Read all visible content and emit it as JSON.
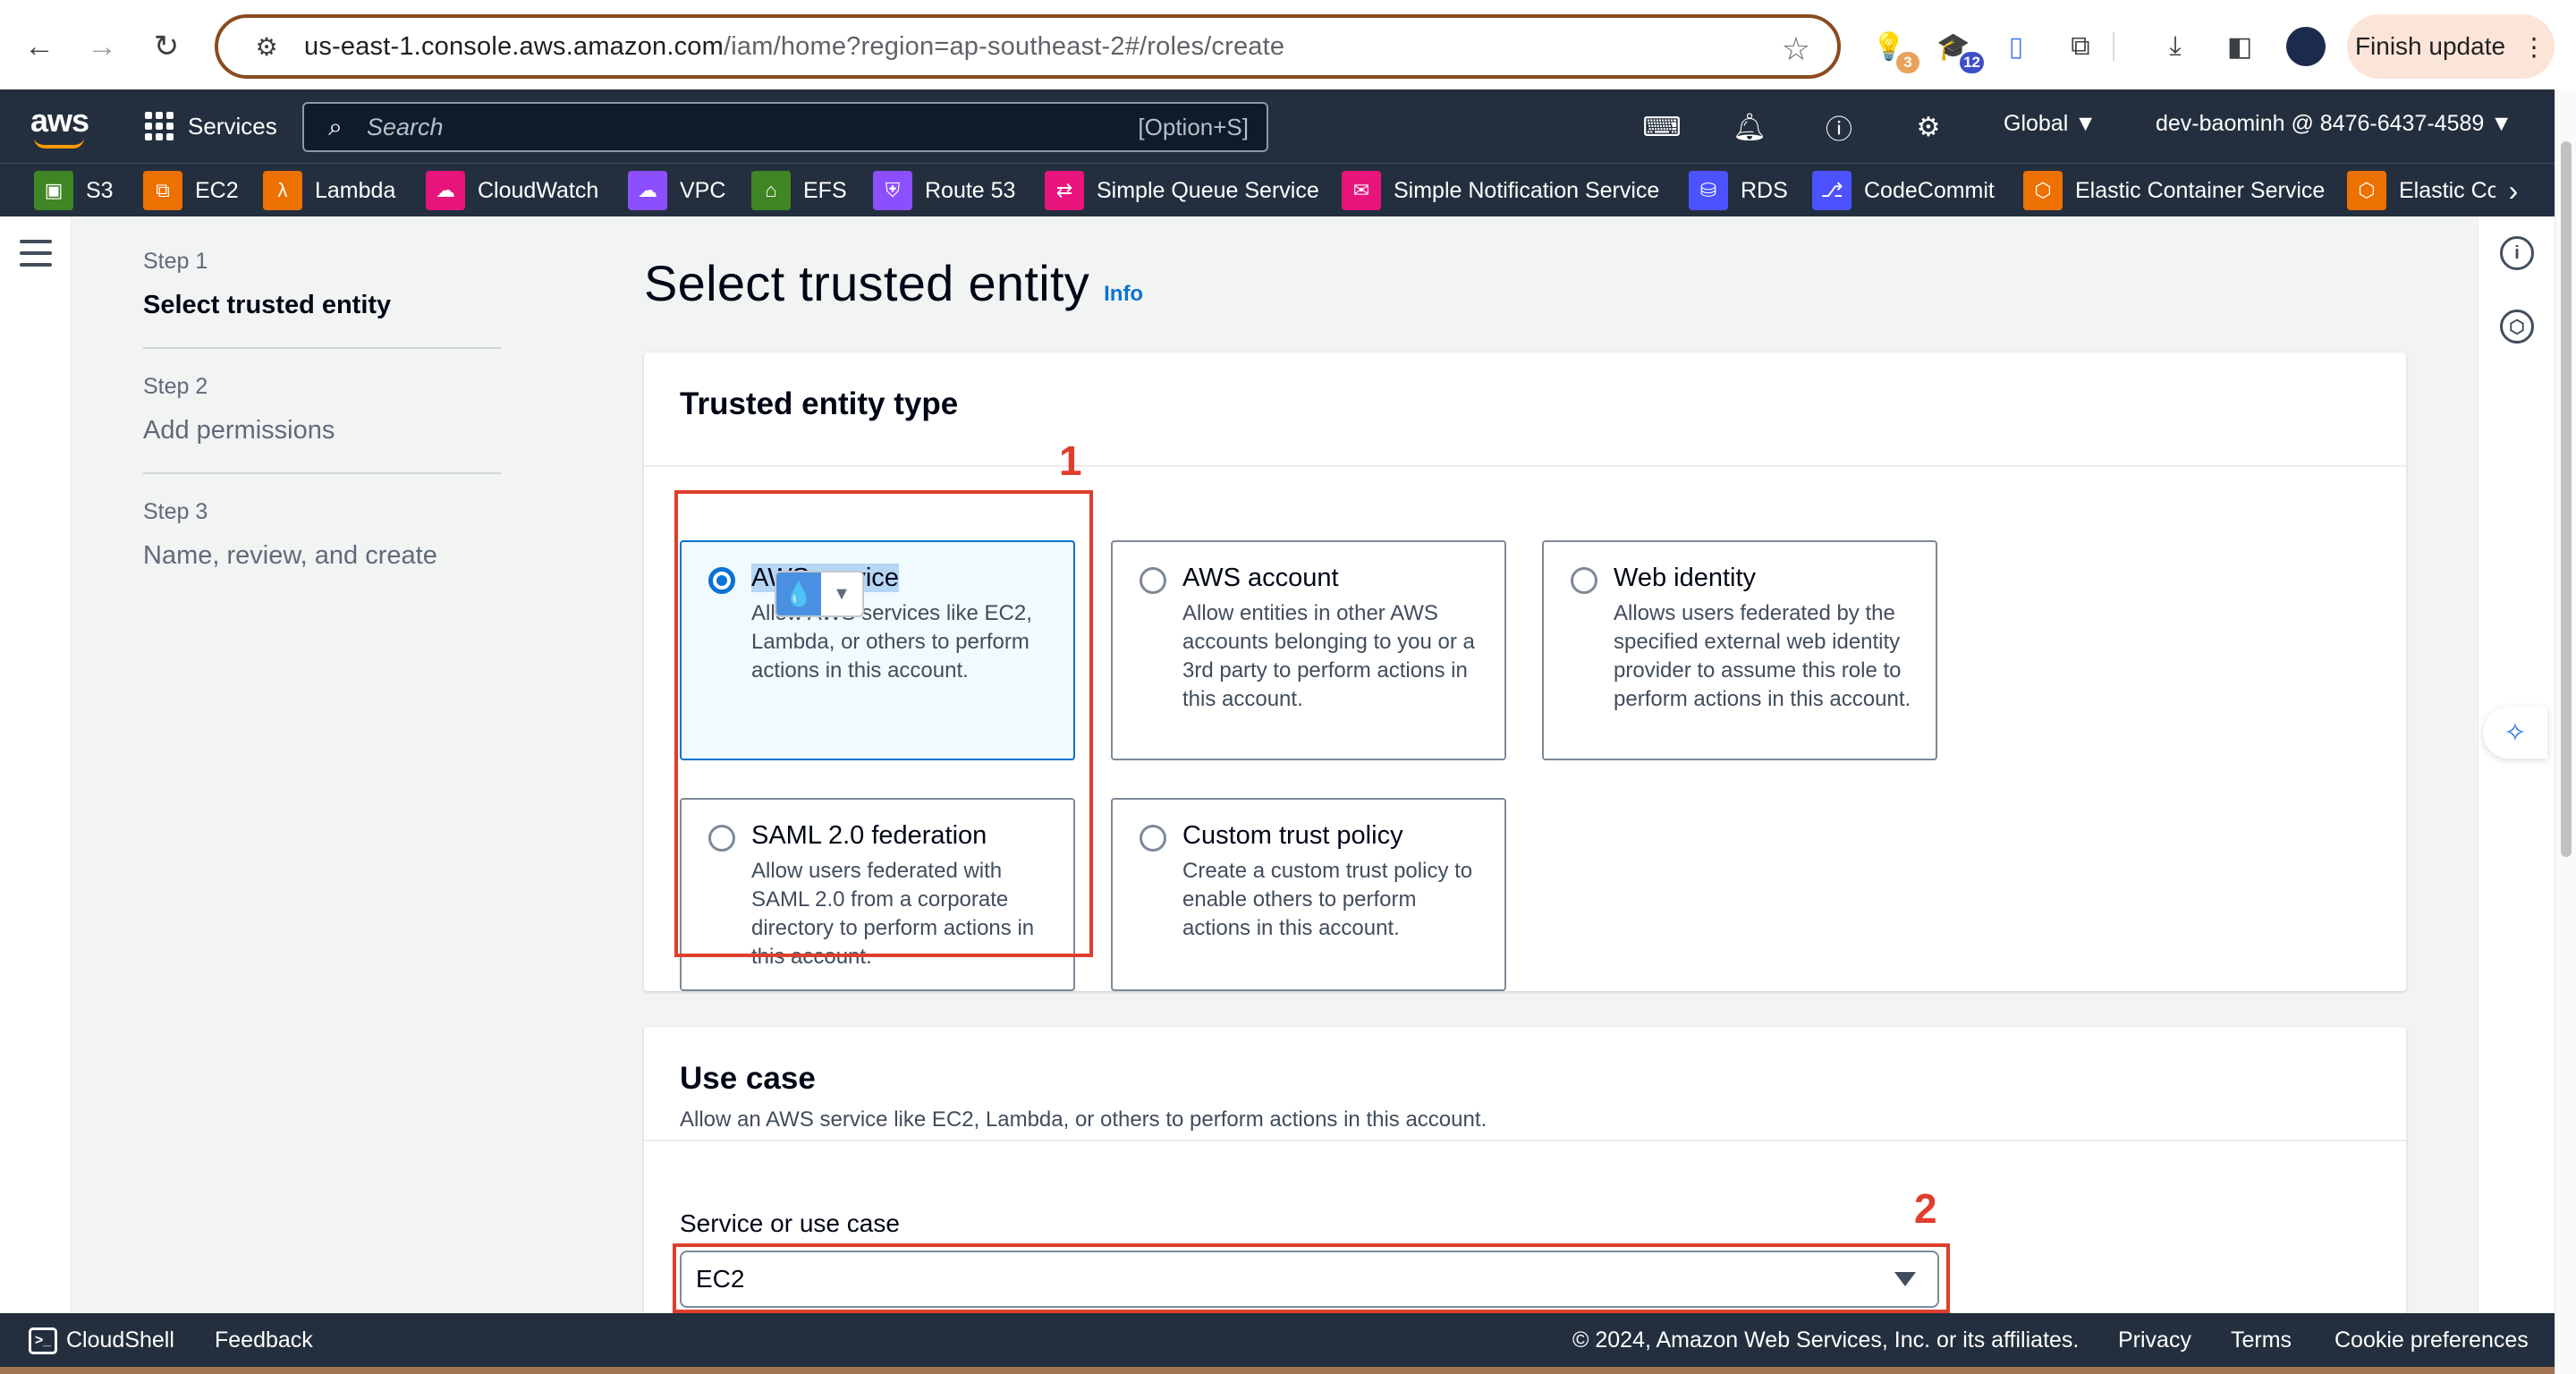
{
  "browser": {
    "url_host": "us-east-1.console.aws.amazon.com",
    "url_path": "/iam/home?region=ap-southeast-2#/roles/create",
    "ext_badge_1": "3",
    "ext_badge_2": "12",
    "finish_update_label": "Finish update"
  },
  "aws_nav": {
    "logo_text": "aws",
    "services_label": "Services",
    "search_placeholder": "Search",
    "search_shortcut": "[Option+S]",
    "region_label": "Global",
    "account_label": "dev-baominh @ 8476-6437-4589"
  },
  "favorites": [
    {
      "label": "S3",
      "color": "#3f8624"
    },
    {
      "label": "EC2",
      "color": "#ed7100"
    },
    {
      "label": "Lambda",
      "color": "#ed7100"
    },
    {
      "label": "CloudWatch",
      "color": "#e7157b"
    },
    {
      "label": "VPC",
      "color": "#8c4fff"
    },
    {
      "label": "EFS",
      "color": "#3f8624"
    },
    {
      "label": "Route 53",
      "color": "#8c4fff"
    },
    {
      "label": "Simple Queue Service",
      "color": "#e7157b"
    },
    {
      "label": "Simple Notification Service",
      "color": "#e7157b"
    },
    {
      "label": "RDS",
      "color": "#4d52ff"
    },
    {
      "label": "CodeCommit",
      "color": "#4d52ff"
    },
    {
      "label": "Elastic Container Service",
      "color": "#ed7100"
    },
    {
      "label": "Elastic Co",
      "color": "#ed7100"
    }
  ],
  "steps": [
    {
      "num": "Step 1",
      "title": "Select trusted entity"
    },
    {
      "num": "Step 2",
      "title": "Add permissions"
    },
    {
      "num": "Step 3",
      "title": "Name, review, and create"
    }
  ],
  "page": {
    "title": "Select trusted entity",
    "info_link": "Info"
  },
  "trusted_entity": {
    "heading": "Trusted entity type",
    "options": [
      {
        "title": "AWS service",
        "desc": "Allow AWS services like EC2, Lambda, or others to perform actions in this account.",
        "selected": true
      },
      {
        "title": "AWS account",
        "desc": "Allow entities in other AWS accounts belonging to you or a 3rd party to perform actions in this account.",
        "selected": false
      },
      {
        "title": "Web identity",
        "desc": "Allows users federated by the specified external web identity provider to assume this role to perform actions in this account.",
        "selected": false
      },
      {
        "title": "SAML 2.0 federation",
        "desc": "Allow users federated with SAML 2.0 from a corporate directory to perform actions in this account.",
        "selected": false
      },
      {
        "title": "Custom trust policy",
        "desc": "Create a custom trust policy to enable others to perform actions in this account.",
        "selected": false
      }
    ]
  },
  "annotations": {
    "one": "1",
    "two": "2"
  },
  "use_case": {
    "heading": "Use case",
    "description": "Allow an AWS service like EC2, Lambda, or others to perform actions in this account.",
    "field_label": "Service or use case",
    "selected_value": "EC2"
  },
  "footer": {
    "cloudshell": "CloudShell",
    "feedback": "Feedback",
    "copyright": "© 2024, Amazon Web Services, Inc. or its affiliates.",
    "privacy": "Privacy",
    "terms": "Terms",
    "cookies": "Cookie preferences"
  },
  "colors": {
    "aws_dark": "#232f3e",
    "selected_blue": "#0972d3",
    "annotation_red": "#e03e2d"
  }
}
